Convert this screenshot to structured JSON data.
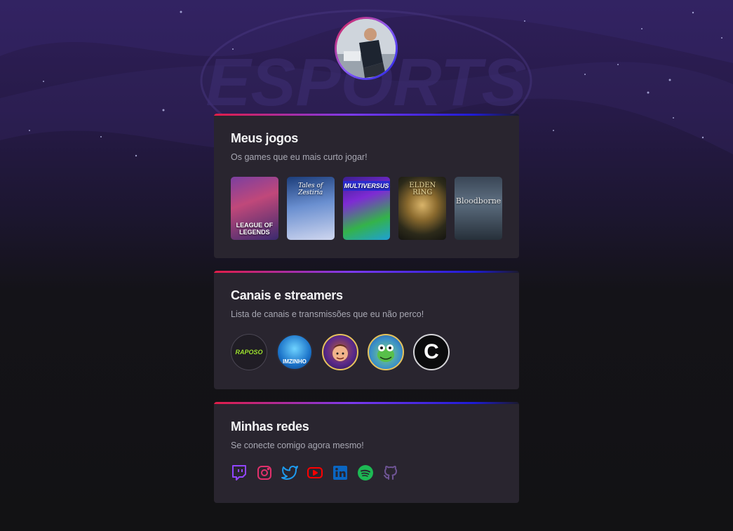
{
  "profile": {
    "avatar_icon": "profile-photo"
  },
  "background": {
    "watermark_text": "ESPORTS"
  },
  "games_section": {
    "title": "Meus jogos",
    "subtitle": "Os games que eu mais curto jogar!",
    "games": [
      {
        "cover_text": "LEAGUE OF LEGENDS"
      },
      {
        "cover_text": "Tales of Zestiria"
      },
      {
        "cover_text": "MULTIVERSUS"
      },
      {
        "cover_text": "ELDEN RING"
      },
      {
        "cover_text": "Bloodborne"
      }
    ]
  },
  "channels_section": {
    "title": "Canais e streamers",
    "subtitle": "Lista de canais e transmissões que eu não perco!",
    "channels": [
      {
        "logo_text": "RAPOSO"
      },
      {
        "logo_text": "IMZINHO"
      },
      {
        "logo_text": ""
      },
      {
        "logo_text": ""
      },
      {
        "logo_text": "C"
      }
    ]
  },
  "social_section": {
    "title": "Minhas redes",
    "subtitle": "Se conecte comigo agora mesmo!",
    "links": [
      {
        "icon": "twitch-icon",
        "color": "#9146ff"
      },
      {
        "icon": "instagram-icon",
        "color": "#e1306c"
      },
      {
        "icon": "twitter-icon",
        "color": "#1d9bf0"
      },
      {
        "icon": "youtube-icon",
        "color": "#ff0000"
      },
      {
        "icon": "linkedin-icon",
        "color": "#0a66c2"
      },
      {
        "icon": "spotify-icon",
        "color": "#1db954"
      },
      {
        "icon": "github-icon",
        "color": "#6e5494"
      }
    ]
  }
}
